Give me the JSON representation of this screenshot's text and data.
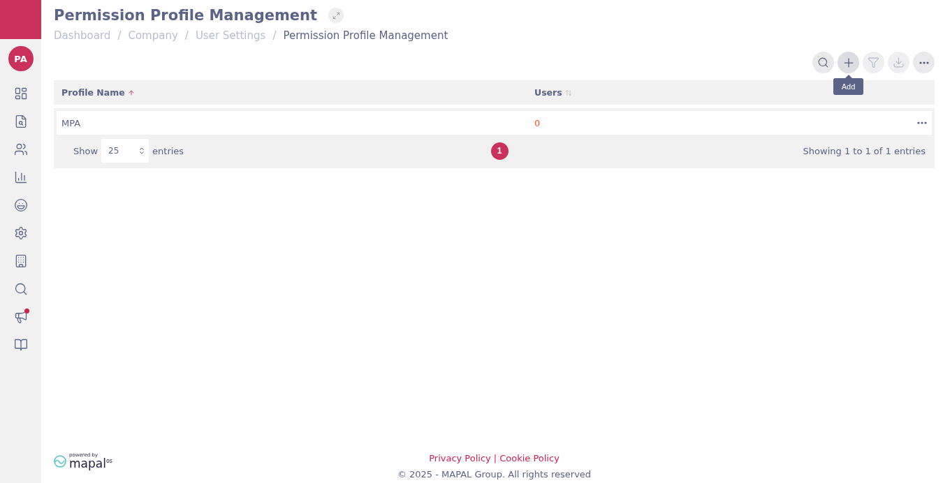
{
  "sidebar": {
    "avatar": "PA",
    "items": [
      {
        "notification": false
      },
      {
        "notification": false
      },
      {
        "notification": false
      },
      {
        "notification": false
      },
      {
        "notification": false
      },
      {
        "notification": false
      },
      {
        "notification": false
      },
      {
        "notification": false
      },
      {
        "notification": true
      },
      {
        "notification": false
      }
    ]
  },
  "header": {
    "title": "Permission Profile Management",
    "breadcrumbs": [
      {
        "label": "Dashboard",
        "current": false
      },
      {
        "label": "Company",
        "current": false
      },
      {
        "label": "User Settings",
        "current": false
      },
      {
        "label": "Permission Profile Management",
        "current": true
      }
    ],
    "separator": "/"
  },
  "toolbar": {
    "buttons": [
      {
        "disabled": false,
        "hovered": false
      },
      {
        "disabled": false,
        "hovered": true
      },
      {
        "disabled": true,
        "hovered": false
      },
      {
        "disabled": true,
        "hovered": false
      },
      {
        "disabled": false,
        "hovered": false
      }
    ],
    "tooltip": "Add"
  },
  "table": {
    "columns": [
      {
        "label": "Profile Name",
        "sorted": true
      },
      {
        "label": "Users",
        "sorted": false
      }
    ],
    "rows": [
      {
        "name": "MPA",
        "users": "0"
      }
    ],
    "footer": {
      "show": "Show",
      "page_size": "25",
      "entries": "entries",
      "pages": [
        {
          "label": "1",
          "selected": true
        }
      ],
      "info": "Showing 1 to 1 of 1 entries"
    }
  },
  "footer": {
    "logo": {
      "caption": "powered by",
      "name": "mapal",
      "suffix": "os"
    },
    "links": [
      {
        "label": "Privacy Policy"
      },
      {
        "label": "Cookie Policy"
      }
    ],
    "link_separator": "|",
    "copyright": "© 2025 - MAPAL Group. All rights reserved"
  }
}
